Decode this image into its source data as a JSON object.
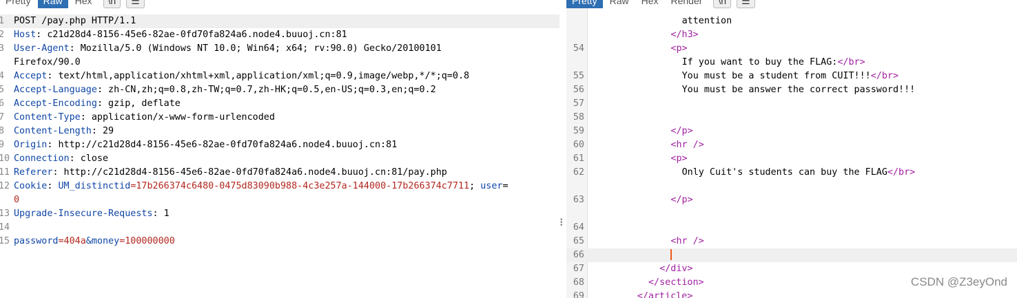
{
  "request_pane": {
    "tabs": [
      "Pretty",
      "Raw",
      "Hex",
      "\\n",
      "☰"
    ],
    "active_tab": "Raw",
    "lines": [
      {
        "n": "1",
        "key": "",
        "text": "POST /pay.php HTTP/1.1"
      },
      {
        "n": "2",
        "key": "Host",
        "text": ": c21d28d4-8156-45e6-82ae-0fd70fa824a6.node4.buuoj.cn:81"
      },
      {
        "n": "3",
        "key": "User-Agent",
        "text": ": Mozilla/5.0 (Windows NT 10.0; Win64; x64; rv:90.0) Gecko/20100101"
      },
      {
        "n": "",
        "key": "",
        "text": "Firefox/90.0"
      },
      {
        "n": "4",
        "key": "Accept",
        "text": ": text/html,application/xhtml+xml,application/xml;q=0.9,image/webp,*/*;q=0.8"
      },
      {
        "n": "5",
        "key": "Accept-Language",
        "text": ": zh-CN,zh;q=0.8,zh-TW;q=0.7,zh-HK;q=0.5,en-US;q=0.3,en;q=0.2"
      },
      {
        "n": "6",
        "key": "Accept-Encoding",
        "text": ": gzip, deflate"
      },
      {
        "n": "7",
        "key": "Content-Type",
        "text": ": application/x-www-form-urlencoded"
      },
      {
        "n": "8",
        "key": "Content-Length",
        "text": ": 29"
      },
      {
        "n": "9",
        "key": "Origin",
        "text": ": http://c21d28d4-8156-45e6-82ae-0fd70fa824a6.node4.buuoj.cn:81"
      },
      {
        "n": "10",
        "key": "Connection",
        "text": ": close"
      },
      {
        "n": "11",
        "key": "Referer",
        "text": ": http://c21d28d4-8156-45e6-82ae-0fd70fa824a6.node4.buuoj.cn:81/pay.php"
      },
      {
        "n": "12",
        "key": "Cookie",
        "text": ": ",
        "ck": "UM_distinctid",
        "cv": "=17b266374c6480-0475d83090b988-4c3e257a-144000-17b266374c7711",
        "ck2": "; user="
      },
      {
        "n": "",
        "key": "",
        "text": "",
        "cv0": "0"
      },
      {
        "n": "13",
        "key": "Upgrade-Insecure-Requests",
        "text": ": 1"
      },
      {
        "n": "14",
        "key": "",
        "text": ""
      },
      {
        "n": "15",
        "key": "",
        "text": "",
        "body": true
      }
    ],
    "body_parts": {
      "k1": "password",
      "v1": "=404a",
      "k2": "&money",
      "v2": "=100000000"
    }
  },
  "response_pane": {
    "tabs": [
      "Pretty",
      "Raw",
      "Hex",
      "Render",
      "\\n",
      "☰"
    ],
    "active_tab": "Pretty",
    "lines": [
      {
        "n": "",
        "indent": 16,
        "parts": [
          {
            "t": "attention",
            "c": "txt"
          }
        ]
      },
      {
        "n": "",
        "indent": 14,
        "parts": [
          {
            "t": "</h3>",
            "c": "tag"
          }
        ]
      },
      {
        "n": "54",
        "indent": 14,
        "parts": [
          {
            "t": "<p>",
            "c": "tag"
          }
        ]
      },
      {
        "n": "",
        "indent": 16,
        "parts": [
          {
            "t": "If you want to buy the FLAG:",
            "c": "txt"
          },
          {
            "t": "</br>",
            "c": "tag"
          }
        ]
      },
      {
        "n": "55",
        "indent": 16,
        "parts": [
          {
            "t": "You must be a student from CUIT!!!",
            "c": "txt"
          },
          {
            "t": "</br>",
            "c": "tag"
          }
        ]
      },
      {
        "n": "56",
        "indent": 16,
        "parts": [
          {
            "t": "You must be answer the correct password!!!",
            "c": "txt"
          }
        ]
      },
      {
        "n": "57",
        "indent": 0,
        "parts": []
      },
      {
        "n": "58",
        "indent": 0,
        "parts": []
      },
      {
        "n": "59",
        "indent": 14,
        "parts": [
          {
            "t": "</p>",
            "c": "tag"
          }
        ]
      },
      {
        "n": "60",
        "indent": 14,
        "parts": [
          {
            "t": "<hr />",
            "c": "tag"
          }
        ]
      },
      {
        "n": "61",
        "indent": 14,
        "parts": [
          {
            "t": "<p>",
            "c": "tag"
          }
        ]
      },
      {
        "n": "62",
        "indent": 16,
        "parts": [
          {
            "t": "Only Cuit's students can buy the FLAG",
            "c": "txt"
          },
          {
            "t": "</br>",
            "c": "tag"
          }
        ]
      },
      {
        "n": "",
        "indent": 0,
        "parts": []
      },
      {
        "n": "63",
        "indent": 14,
        "parts": [
          {
            "t": "</p>",
            "c": "tag"
          }
        ]
      },
      {
        "n": "",
        "indent": 0,
        "parts": []
      },
      {
        "n": "64",
        "indent": 0,
        "parts": []
      },
      {
        "n": "65",
        "indent": 14,
        "parts": [
          {
            "t": "<hr />",
            "c": "tag"
          }
        ]
      },
      {
        "n": "66",
        "indent": 14,
        "parts": [],
        "caret": true
      },
      {
        "n": "67",
        "indent": 12,
        "parts": [
          {
            "t": "</div>",
            "c": "tag"
          }
        ]
      },
      {
        "n": "68",
        "indent": 10,
        "parts": [
          {
            "t": "</section>",
            "c": "tag"
          }
        ]
      },
      {
        "n": "69",
        "indent": 8,
        "parts": [
          {
            "t": "</article>",
            "c": "tag"
          }
        ]
      }
    ]
  },
  "watermark": "CSDN @Z3eyOnd",
  "colors": {
    "active_tab": "#2e6eb2",
    "header_key": "#0f46a6",
    "param_value": "#b3261e",
    "tag": "#a01fa0",
    "caret": "#f05a1a"
  }
}
